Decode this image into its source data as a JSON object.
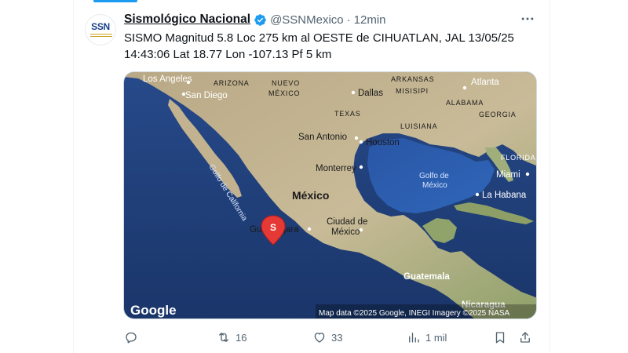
{
  "tweet": {
    "display_name": "Sismológico Nacional",
    "handle": "@SSNMexico",
    "separator": "·",
    "time": "12min",
    "avatar_text": "SSN",
    "text_line1": "SISMO Magnitud 5.8 Loc  275 km al OESTE de CIHUATLAN, JAL 13/05/25",
    "text_line2": "14:43:06 Lat 18.77 Lon -107.13 Pf 5 km"
  },
  "map": {
    "labels": {
      "los_angeles": "Los Angeles",
      "san_diego": "San Diego",
      "arizona": "ARIZONA",
      "nuevo_mexico_1": "NUEVO",
      "nuevo_mexico_2": "MÉXICO",
      "arkansas": "ARKANSAS",
      "atlanta": "Atlanta",
      "misisipi": "MISISIPI",
      "alabama": "ALABAMA",
      "georgia": "GEORGIA",
      "dallas": "Dallas",
      "texas": "TEXAS",
      "luisiana": "LUISIANA",
      "san_antonio": "San Antonio",
      "houston": "Houston",
      "florida": "FLORIDA",
      "miami": "Miami",
      "monterrey": "Monterrey",
      "golfo_mexico_1": "Golfo de",
      "golfo_mexico_2": "México",
      "golfo_california": "Golfo de California",
      "mexico": "México",
      "la_habana": "La Habana",
      "guadalajara": "Guadalajara",
      "ciudad_mexico_1": "Ciudad de",
      "ciudad_mexico_2": "México",
      "guatemala": "Guatemala",
      "nicaragua": "Nicaragua",
      "marker": "S"
    },
    "google_logo": "Google",
    "attribution": "Map data ©2025 Google, INEGI Imagery ©2025 NASA"
  },
  "actions": {
    "reply_count": "",
    "retweet_count": "16",
    "like_count": "33",
    "views_count": "1 mil"
  },
  "colors": {
    "accent": "#1d9bf0",
    "marker": "#e53935",
    "ocean": "#1f3d7a",
    "land": "#c9ba97"
  }
}
